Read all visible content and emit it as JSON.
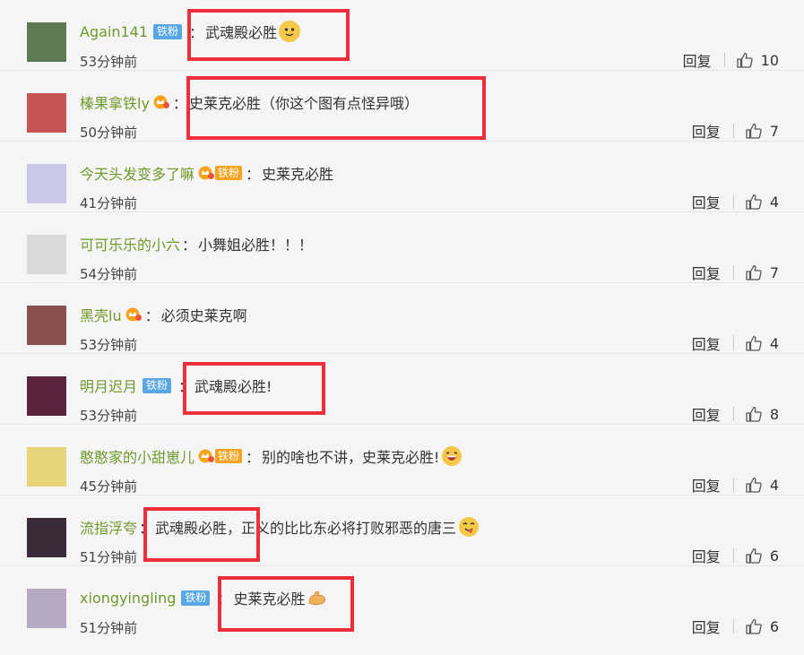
{
  "reply_label": "回复",
  "comments": [
    {
      "user": "Again141",
      "badge": "fan",
      "badge_label": "铁粉",
      "text": "武魂殿必胜",
      "emoji": "doge",
      "time": "53分钟前",
      "likes": "10",
      "avatar_color": "#5f7a55"
    },
    {
      "user": "榛果拿铁ly",
      "badge": "vip",
      "badge_label": "",
      "text": "史莱克必胜（你这个图有点怪异哦）",
      "emoji": "",
      "time": "50分钟前",
      "likes": "7",
      "avatar_color": "#c85555"
    },
    {
      "user": "今天头发变多了嘛",
      "badge": "vip",
      "badge_label": "铁粉",
      "text": "史莱克必胜",
      "emoji": "",
      "time": "41分钟前",
      "likes": "4",
      "avatar_color": "#c9c8e8"
    },
    {
      "user": "可可乐乐的小六",
      "badge": "",
      "badge_label": "",
      "text": "小舞姐必胜！！！",
      "emoji": "",
      "time": "54分钟前",
      "likes": "7",
      "avatar_color": "#d9d9d9"
    },
    {
      "user": "黑壳lu",
      "badge": "vip",
      "badge_label": "",
      "text": "必须史莱克啊",
      "emoji": "",
      "time": "53分钟前",
      "likes": "4",
      "avatar_color": "#8a5050"
    },
    {
      "user": "明月迟月",
      "badge": "fan",
      "badge_label": "铁粉",
      "text": "武魂殿必胜!",
      "emoji": "",
      "time": "53分钟前",
      "likes": "8",
      "avatar_color": "#5a2340"
    },
    {
      "user": "憨憨家的小甜崽儿",
      "badge": "vip",
      "badge_label": "铁粉",
      "text": "别的啥也不讲，史莱克必胜!",
      "emoji": "laugh",
      "time": "45分钟前",
      "likes": "4",
      "avatar_color": "#e8d27a"
    },
    {
      "user": "流指浮夸",
      "badge": "",
      "badge_label": "",
      "text": "武魂殿必胜，正义的比比东必将打败邪恶的唐三",
      "emoji": "yum",
      "time": "51分钟前",
      "likes": "6",
      "avatar_color": "#3a2a3a"
    },
    {
      "user": "xiongyingling",
      "badge": "fan",
      "badge_label": "铁粉",
      "text": "史莱克必胜",
      "emoji": "muscle",
      "time": "51分钟前",
      "likes": "6",
      "avatar_color": "#b8a9c2"
    }
  ]
}
